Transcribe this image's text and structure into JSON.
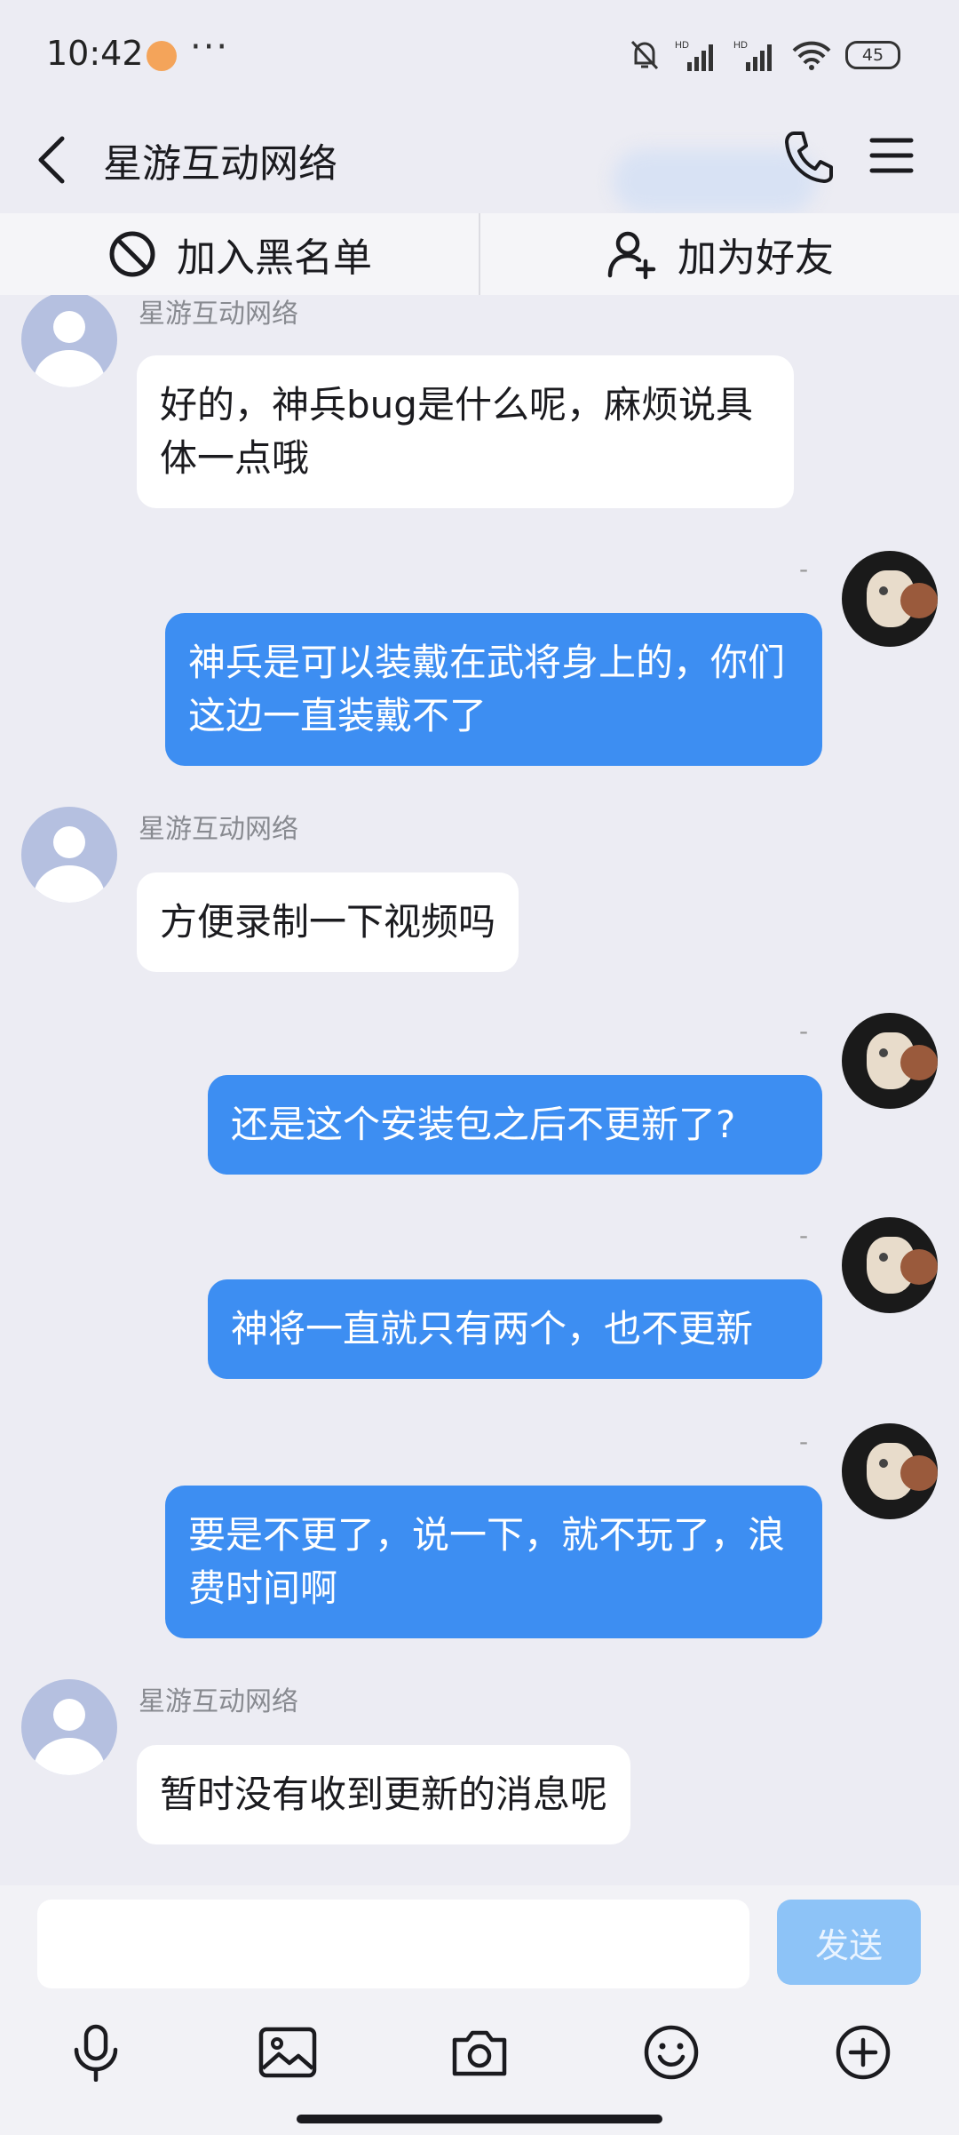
{
  "status_bar": {
    "time": "10:42",
    "more": "···",
    "battery": "45"
  },
  "header": {
    "title": "星游互动网络"
  },
  "actions": {
    "block_label": "加入黑名单",
    "add_friend_label": "加为好友"
  },
  "messages": [
    {
      "direction": "in",
      "sender": "星游互动网络",
      "text": "好的，神兵bug是什么呢，麻烦说具体一点哦"
    },
    {
      "direction": "out",
      "meta": "-",
      "text": "神兵是可以装戴在武将身上的，你们这边一直装戴不了"
    },
    {
      "direction": "in",
      "sender": "星游互动网络",
      "text": "方便录制一下视频吗"
    },
    {
      "direction": "out",
      "meta": "-",
      "text": "还是这个安装包之后不更新了?"
    },
    {
      "direction": "out",
      "meta": "-",
      "text": "神将一直就只有两个，也不更新"
    },
    {
      "direction": "out",
      "meta": "-",
      "text": "要是不更了，说一下，就不玩了，浪费时间啊"
    },
    {
      "direction": "in",
      "sender": "星游互动网络",
      "text": "暂时没有收到更新的消息呢"
    }
  ],
  "input": {
    "value": "",
    "send_label": "发送"
  },
  "toolbar_icons": [
    "microphone-icon",
    "image-icon",
    "camera-icon",
    "emoji-icon",
    "plus-icon"
  ],
  "colors": {
    "background": "#ececf3",
    "outgoing_bubble": "#3d8ef2",
    "incoming_bubble": "#ffffff",
    "send_button": "#8dc3f7"
  }
}
